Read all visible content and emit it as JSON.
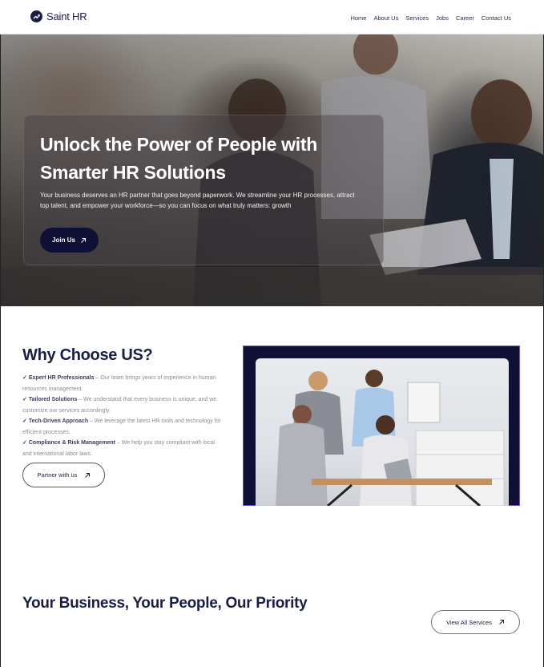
{
  "header": {
    "logo_text": "Saint HR",
    "nav": [
      "Home",
      "About Us",
      "Services",
      "Jobs",
      "Career",
      "Contact Us"
    ]
  },
  "hero": {
    "title": "Unlock the Power of People with Smarter HR Solutions",
    "description": "Your business deserves an HR partner that goes beyond paperwork. We streamline your HR processes, attract top talent, and empower your workforce—so you can focus on what truly matters: growth",
    "button_label": "Join Us"
  },
  "why": {
    "title": "Why Choose US?",
    "items": [
      {
        "check": "✓",
        "heading": "Expert HR Professionals",
        "text": " – Our team brings years of experience in human resources management."
      },
      {
        "check": "✓",
        "heading": "Tailored Solutions",
        "text": " – We understand that every business is unique, and we customize our services accordingly."
      },
      {
        "check": "✓",
        "heading": "Tech-Driven Approach",
        "text": " – We leverage the latest HR tools and technology for efficient processes."
      },
      {
        "check": "✓",
        "heading": "Compliance & Risk Management",
        "text": " – We help you stay compliant with local and international labor laws."
      }
    ],
    "button_label": "Partner with us"
  },
  "business": {
    "title": "Your Business, Your People, Our Priority",
    "button_label": "View All Services"
  },
  "colors": {
    "brand_navy": "#0e1035",
    "frame_accent": "#6b4fd6"
  }
}
